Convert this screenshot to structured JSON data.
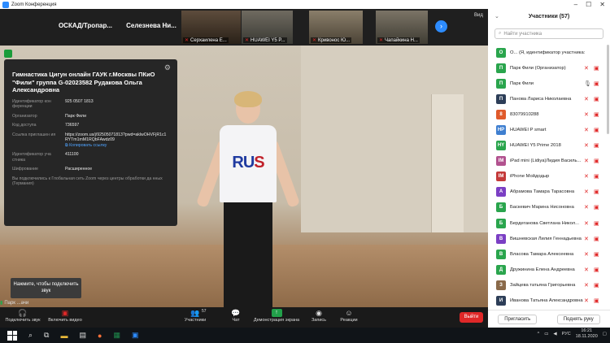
{
  "window": {
    "title": "Zoom Конференция",
    "view_label": "Вид"
  },
  "strip": {
    "tiles": [
      {
        "name": "ОСКАД/Тропар...",
        "muted": false,
        "big": true
      },
      {
        "name": "Селезнева  Ни...",
        "muted": true,
        "big": true
      },
      {
        "name": "Серхаилена Е...",
        "muted": true,
        "big": false
      },
      {
        "name": "HUAWEI Y5 P...",
        "muted": true,
        "big": false
      },
      {
        "name": "Кривонос Ю...",
        "muted": true,
        "big": false
      },
      {
        "name": "Чапайкина Н...",
        "muted": true,
        "big": false
      }
    ],
    "next": "›"
  },
  "info": {
    "title": "Гимнастика Цигун онлайн ГАУК г.Москвы ПКиО \"Фили\" группа G-02023582 Рудакова Ольга Александровна",
    "rows": [
      {
        "k": "Идентификатор кон ференции",
        "v": "925 0507 1813"
      },
      {
        "k": "Организатор",
        "v": "Парк Фили"
      },
      {
        "k": "Код доступа",
        "v": "736597"
      }
    ],
    "link_label": "Ссылка приглашен ия",
    "link_value": "https://zoom.us/j/92505071813?pwd=aklwOHVFjR1c1RYTm1mM1RQbFAwdz09",
    "copy_label": "Копировать ссылку",
    "rows2": [
      {
        "k": "Идентификатор уча стника",
        "v": "411100"
      },
      {
        "k": "Шифрование",
        "v": "Расширенное"
      }
    ],
    "note": "Вы подключились к Глобальная сеть Zoom через центры обработки да нных (Германия)"
  },
  "video": {
    "shirt_text_a": "RU",
    "shirt_text_b": "S"
  },
  "tooltip": {
    "text": "Нажмите, чтобы подключить звук"
  },
  "speaker": {
    "label": "Парк ...ачи"
  },
  "toolbar": {
    "join_audio": "Подключить звук",
    "start_video": "Включить видео",
    "participants": "Участники",
    "participants_count": "57",
    "chat": "Чат",
    "share": "Демонстрация экрана",
    "record": "Запись",
    "reactions": "Реакции",
    "end": "Выйти"
  },
  "panel": {
    "title": "Участники (57)",
    "search_placeholder": "Найти участника",
    "participants": [
      {
        "initial": "О",
        "color": "#2aa54d",
        "name": "О... (Я, идентификатор участника: 411100)",
        "mic": "none",
        "cam": "none"
      },
      {
        "initial": "П",
        "color": "#2aa54d",
        "name": "Парк Фили (Организатор)",
        "mic": "muted",
        "cam": "off"
      },
      {
        "initial": "П",
        "color": "#2aa54d",
        "name": "Парк Фили",
        "mic": "on",
        "cam": "off"
      },
      {
        "initial": "П",
        "color": "#2d3e58",
        "name": "Панова Лариса Николаевна",
        "mic": "muted",
        "cam": "off"
      },
      {
        "initial": "8",
        "color": "#e05a2b",
        "name": "83079910288",
        "mic": "muted",
        "cam": "off"
      },
      {
        "initial": "HP",
        "color": "#3f7fd0",
        "name": "HUAWEI P smart",
        "mic": "muted",
        "cam": "off"
      },
      {
        "initial": "HY",
        "color": "#2aa54d",
        "name": "HUAWEI Y5 Prime 2018",
        "mic": "muted",
        "cam": "off"
      },
      {
        "initial": "IM",
        "color": "#b2528f",
        "name": "iPad mini (Lidiya)Лидия Василь...",
        "mic": "muted",
        "cam": "off"
      },
      {
        "initial": "IM",
        "color": "#c43a3a",
        "name": "iPhone Мойдодыр",
        "mic": "muted",
        "cam": "off"
      },
      {
        "initial": "А",
        "color": "#7b3fc4",
        "name": "Абрамова Тамара Тарасовна",
        "mic": "muted",
        "cam": "off"
      },
      {
        "initial": "Б",
        "color": "#2aa54d",
        "name": "Баскевич Марина Нисоновна",
        "mic": "muted",
        "cam": "off"
      },
      {
        "initial": "Б",
        "color": "#2aa54d",
        "name": "Бердеганова Светлана Никол...",
        "mic": "muted",
        "cam": "off"
      },
      {
        "initial": "В",
        "color": "#7b3fc4",
        "name": "Вишневская Лилия Геннадьевна",
        "mic": "muted",
        "cam": "off"
      },
      {
        "initial": "В",
        "color": "#2aa54d",
        "name": "Власова Тамара Алексеевна",
        "mic": "muted",
        "cam": "off"
      },
      {
        "initial": "Д",
        "color": "#2aa54d",
        "name": "Дружинина Елена Андреевна",
        "mic": "muted",
        "cam": "off"
      },
      {
        "initial": "З",
        "color": "#8a6a4a",
        "name": "Зайцева татьяна  Григорьевна",
        "mic": "muted",
        "cam": "off"
      },
      {
        "initial": "И",
        "color": "#2d3e58",
        "name": "Иванова Татьяна Александровна",
        "mic": "muted",
        "cam": "off"
      }
    ],
    "invite": "Пригласить",
    "raise": "Поднять руку"
  },
  "taskbar": {
    "lang": "РУС",
    "time": "16:21",
    "date": "18.11.2020"
  }
}
